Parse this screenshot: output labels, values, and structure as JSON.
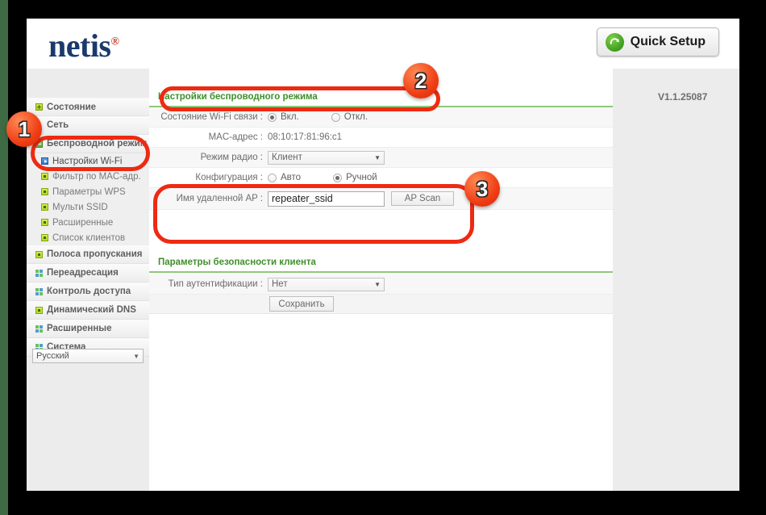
{
  "header": {
    "logo_text": "netis",
    "logo_reg": "®",
    "quick_setup_label": "Quick Setup",
    "quick_setup_icon": "refresh-arrow-icon"
  },
  "version": {
    "text": "V1.1.25087"
  },
  "sidebar": {
    "items": [
      {
        "label": "Состояние",
        "icon": "plus-box-icon",
        "expanded": false
      },
      {
        "label": "Сеть",
        "icon": "none",
        "expanded": false
      },
      {
        "label": "Беспроводной режим",
        "icon": "minus-box-icon",
        "expanded": true
      },
      {
        "label": "Полоса пропускания",
        "icon": "dot-box-icon",
        "expanded": false
      },
      {
        "label": "Переадресация",
        "icon": "grid-box-icon",
        "expanded": false
      },
      {
        "label": "Контроль доступа",
        "icon": "grid-box-icon",
        "expanded": false
      },
      {
        "label": "Динамический DNS",
        "icon": "dot-box-icon",
        "expanded": false
      },
      {
        "label": "Расширенные",
        "icon": "grid-box-icon",
        "expanded": false
      },
      {
        "label": "Система",
        "icon": "grid-box-icon",
        "expanded": false
      }
    ],
    "wireless_subitems": [
      {
        "label": "Настройки Wi-Fi",
        "icon": "arrow-box-icon",
        "active": true
      },
      {
        "label": "Фильтр по MAC-адр.",
        "icon": "dot-box-icon",
        "active": false
      },
      {
        "label": "Параметры WPS",
        "icon": "dot-box-icon",
        "active": false
      },
      {
        "label": "Мульти SSID",
        "icon": "dot-box-icon",
        "active": false
      },
      {
        "label": "Расширенные",
        "icon": "dot-box-icon",
        "active": false
      },
      {
        "label": "Список клиентов",
        "icon": "dot-box-icon",
        "active": false
      }
    ],
    "language": {
      "value": "Русский",
      "caret": "▼"
    }
  },
  "content": {
    "section1_title": "Настройки беспроводного режима",
    "section2_title": "Параметры безопасности клиента",
    "rows": {
      "wifi_state": {
        "label": "Состояние Wi-Fi связи :",
        "option_on": "Вкл.",
        "option_off": "Откл.",
        "selected": "on"
      },
      "mac": {
        "label": "MAC-адрес :",
        "value": "08:10:17:81:96:c1"
      },
      "radio_mode": {
        "label": "Режим радио :",
        "value": "Клиент",
        "caret": "▼"
      },
      "configuration": {
        "label": "Конфигурация :",
        "option_auto": "Авто",
        "option_manual": "Ручной",
        "selected": "manual"
      },
      "remote_ap": {
        "label": "Имя удаленной AP :",
        "value": "repeater_ssid",
        "scan_button": "AP Scan"
      },
      "auth_type": {
        "label": "Тип аутентификации :",
        "value": "Нет",
        "caret": "▼"
      }
    },
    "save_button": "Сохранить"
  },
  "annotations": {
    "badge1": "1",
    "badge2": "2",
    "badge3": "3",
    "highlight_color": "#ee2a12"
  }
}
